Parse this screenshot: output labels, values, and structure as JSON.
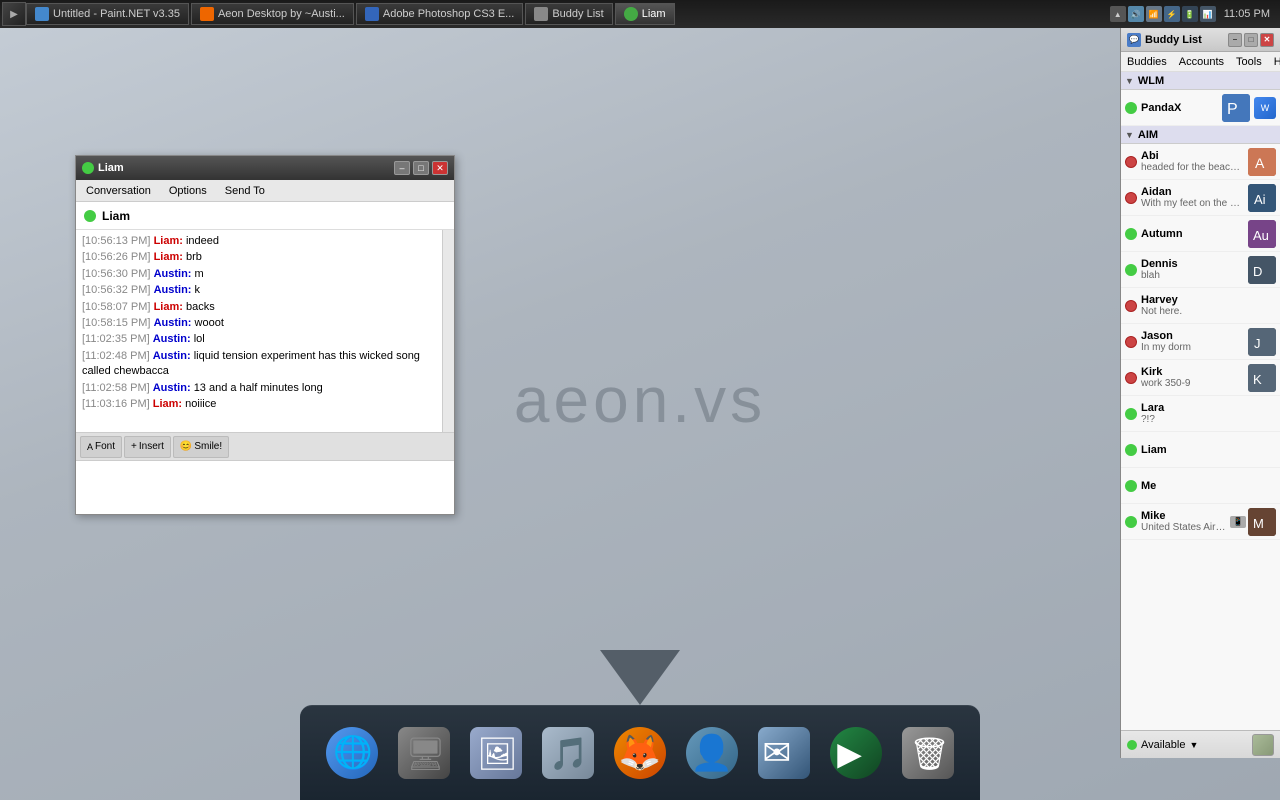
{
  "desktop": {
    "logo": "aeon.vs"
  },
  "taskbar": {
    "time": "11:05 PM",
    "tabs": [
      {
        "id": "paint",
        "label": "Untitled - Paint.NET v3.35",
        "color": "#4488cc"
      },
      {
        "id": "aeon",
        "label": "Aeon Desktop by ~Austi...",
        "color": "#ee6600"
      },
      {
        "id": "photoshop",
        "label": "Adobe Photoshop CS3 E...",
        "color": "#3366bb"
      },
      {
        "id": "buddylist",
        "label": "Buddy List",
        "color": "#888888"
      },
      {
        "id": "liam",
        "label": "Liam",
        "color": "#44aa44",
        "active": true
      }
    ]
  },
  "buddy_list": {
    "title": "Buddy List",
    "menus": [
      "Buddies",
      "Accounts",
      "Tools",
      "He"
    ],
    "sections": [
      {
        "name": "WLM",
        "buddies": [
          {
            "name": "PandaX",
            "status": "online",
            "status_text": "",
            "avatar_class": "avatar-pandax"
          }
        ]
      },
      {
        "name": "AIM",
        "buddies": [
          {
            "name": "Abi",
            "status": "offline",
            "status_text": "headed for the beach, ca...",
            "avatar_class": "avatar-abi"
          },
          {
            "name": "Aidan",
            "status": "offline",
            "status_text": "With my feet on the das...",
            "avatar_class": "avatar-aidan"
          },
          {
            "name": "Autumn",
            "status": "online",
            "status_text": "",
            "avatar_class": "avatar-autumn"
          },
          {
            "name": "Dennis",
            "status": "online",
            "status_text": "blah",
            "avatar_class": "avatar-dennis"
          },
          {
            "name": "Harvey",
            "status": "offline",
            "status_text": "Not here.",
            "avatar_class": "avatar-harvey"
          },
          {
            "name": "Jason",
            "status": "offline",
            "status_text": "In my dorm",
            "avatar_class": "avatar-jason"
          },
          {
            "name": "Kirk",
            "status": "offline",
            "status_text": "work 350-9",
            "avatar_class": "avatar-kirk"
          },
          {
            "name": "Lara",
            "status": "online",
            "status_text": "?!?",
            "avatar_class": "avatar-lara"
          },
          {
            "name": "Liam",
            "status": "online",
            "status_text": "",
            "avatar_class": "avatar-liam"
          },
          {
            "name": "Me",
            "status": "online",
            "status_text": "",
            "avatar_class": "avatar-me"
          },
          {
            "name": "Mike",
            "status": "online",
            "status_text": "United States Air F...",
            "avatar_class": "avatar-mike"
          }
        ]
      }
    ],
    "footer": {
      "status": "Available"
    }
  },
  "chat": {
    "title": "Liam",
    "contact": "Liam",
    "menus": [
      "Conversation",
      "Options",
      "Send To"
    ],
    "messages": [
      {
        "time": "[10:56:13 PM]",
        "user": "Liam",
        "user_type": "liam",
        "text": "indeed"
      },
      {
        "time": "[10:56:26 PM]",
        "user": "Liam",
        "user_type": "liam",
        "text": "brb"
      },
      {
        "time": "[10:56:30 PM]",
        "user": "Austin",
        "user_type": "austin",
        "text": "m"
      },
      {
        "time": "[10:56:32 PM]",
        "user": "Austin",
        "user_type": "austin",
        "text": "k"
      },
      {
        "time": "[10:58:07 PM]",
        "user": "Liam",
        "user_type": "liam",
        "text": "backs"
      },
      {
        "time": "[10:58:15 PM]",
        "user": "Austin",
        "user_type": "austin",
        "text": "wooot"
      },
      {
        "time": "[11:02:35 PM]",
        "user": "Austin",
        "user_type": "austin",
        "text": "lol"
      },
      {
        "time": "[11:02:48 PM]",
        "user": "Austin",
        "user_type": "austin",
        "text": "liquid tension experiment has this wicked song called chewbacca"
      },
      {
        "time": "[11:02:58 PM]",
        "user": "Austin",
        "user_type": "austin",
        "text": "13 and a half minutes long"
      },
      {
        "time": "[11:03:16 PM]",
        "user": "Liam",
        "user_type": "liam",
        "text": "noiiice"
      }
    ],
    "toolbar": {
      "font_label": "Font",
      "insert_label": "Insert",
      "smile_label": "Smile!"
    }
  },
  "dock": {
    "items": [
      {
        "id": "finder",
        "label": "Finder",
        "class": "dock-finder"
      },
      {
        "id": "finder2",
        "label": "Finder Alt",
        "class": "dock-finder2"
      },
      {
        "id": "photos",
        "label": "Photos",
        "class": "dock-photos"
      },
      {
        "id": "music",
        "label": "Music",
        "class": "dock-music"
      },
      {
        "id": "firefox",
        "label": "Firefox",
        "class": "dock-ff"
      },
      {
        "id": "users",
        "label": "Users",
        "class": "dock-users"
      },
      {
        "id": "mail",
        "label": "Mail",
        "class": "dock-mail"
      },
      {
        "id": "itunes",
        "label": "iTunes",
        "class": "dock-itunes"
      },
      {
        "id": "trash",
        "label": "Trash",
        "class": "dock-trash"
      }
    ]
  }
}
